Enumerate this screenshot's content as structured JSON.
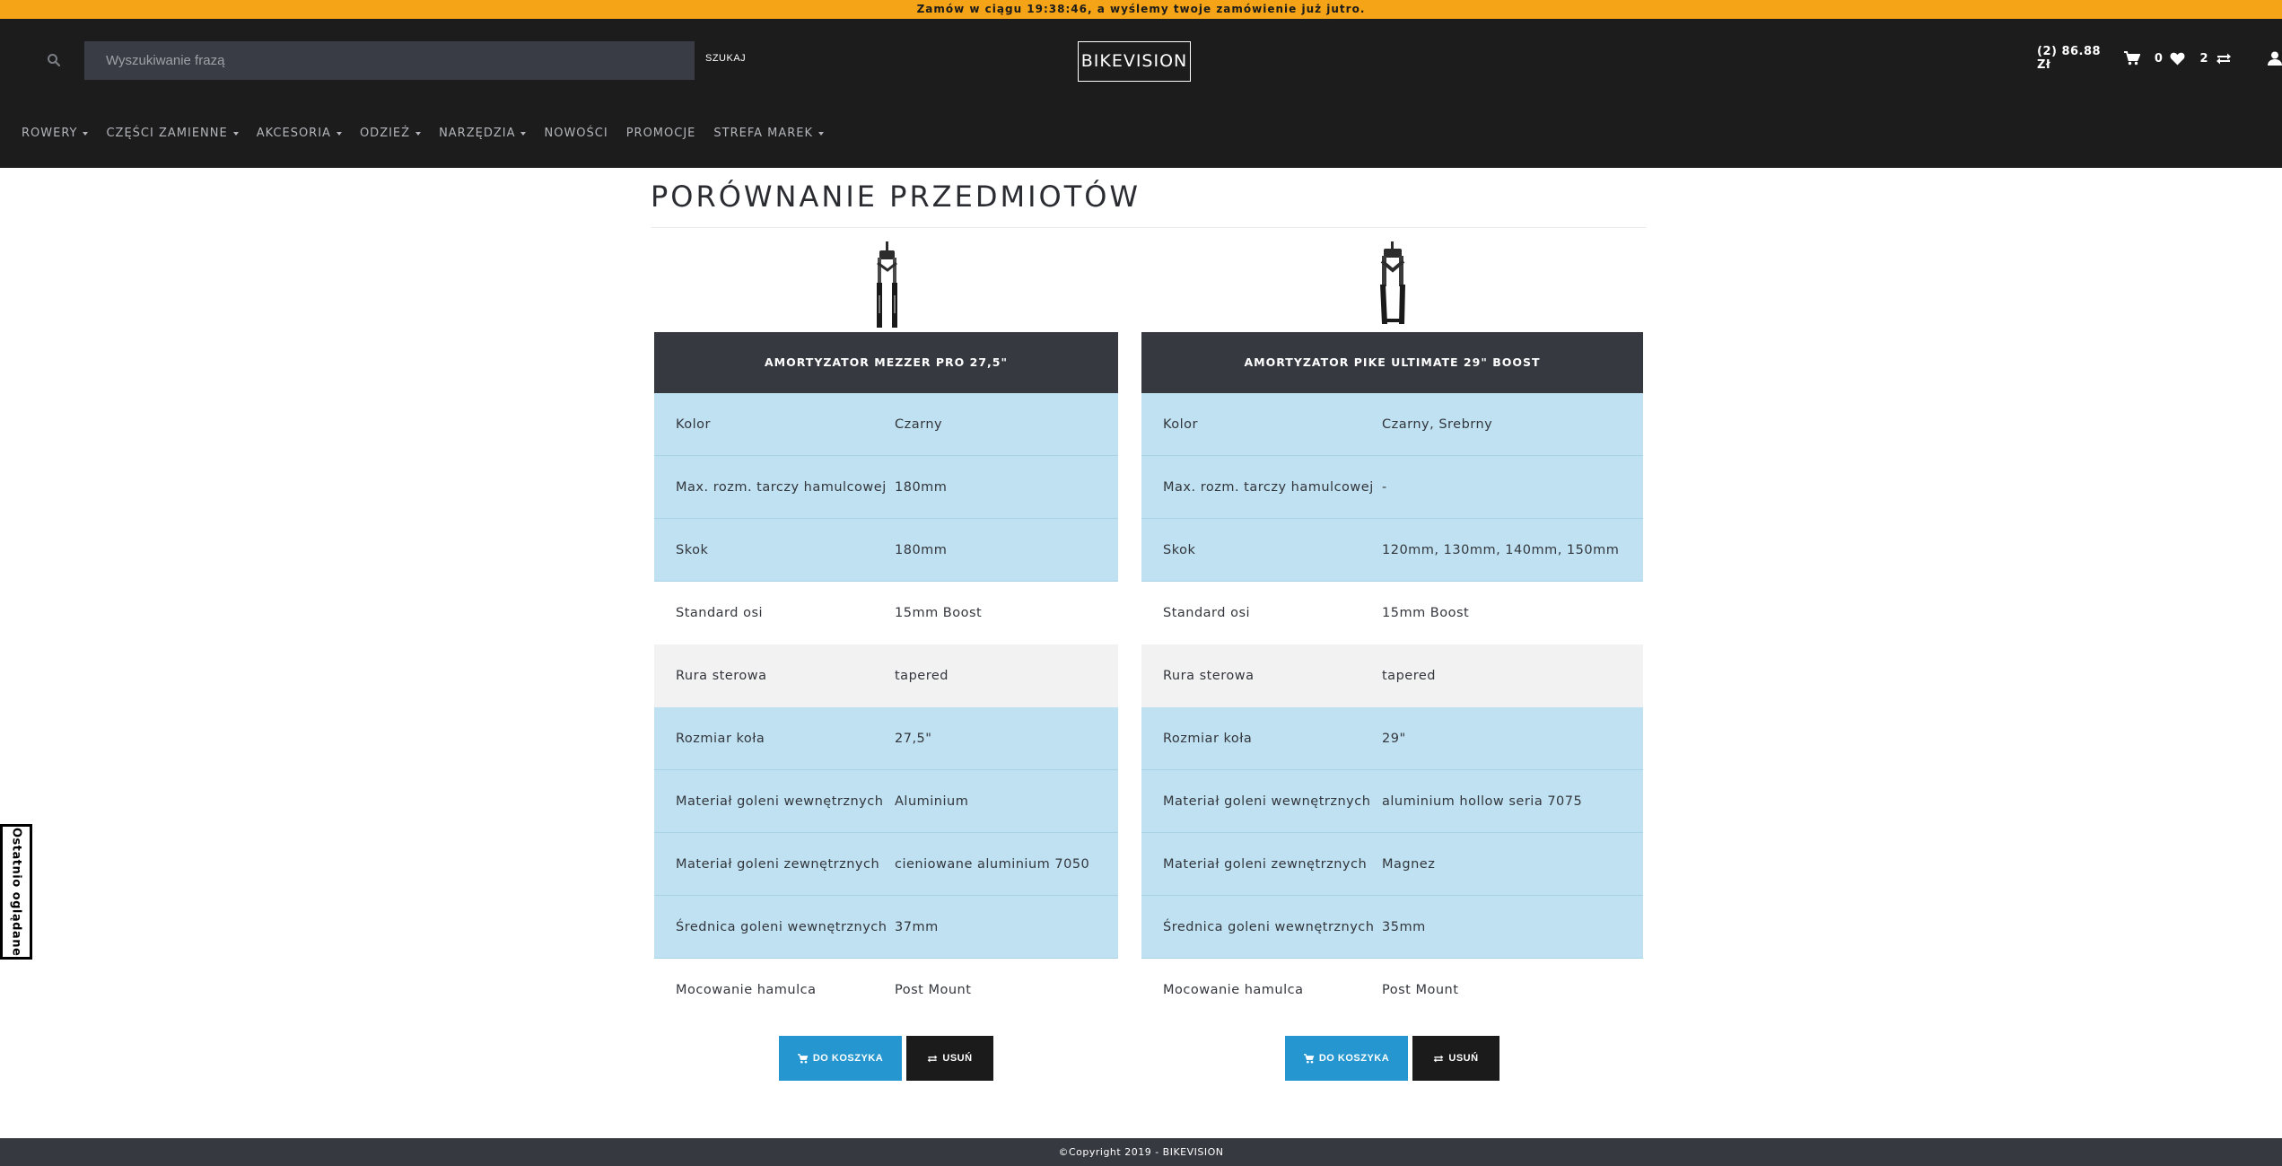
{
  "promo_bar": {
    "text": "Zamów w ciągu 19:38:46, a wyślemy twoje zamówienie już jutro."
  },
  "header": {
    "search": {
      "placeholder": "Wyszukiwanie frazą",
      "button_label": "SZUKAJ",
      "icon": "search-icon"
    },
    "logo": "BIKEVISION",
    "cart": {
      "label": "(2) 86.88 Zł",
      "icon": "cart-icon"
    },
    "wishlist": {
      "count": "0",
      "icon": "heart-icon"
    },
    "compare": {
      "count": "2",
      "icon": "compare-icon"
    },
    "account": {
      "icon": "user-icon"
    }
  },
  "nav": [
    {
      "label": "ROWERY",
      "has_dropdown": true
    },
    {
      "label": "CZĘŚCI ZAMIENNE",
      "has_dropdown": true
    },
    {
      "label": "AKCESORIA",
      "has_dropdown": true
    },
    {
      "label": "ODZIEŻ",
      "has_dropdown": true
    },
    {
      "label": "NARZĘDZIA",
      "has_dropdown": true
    },
    {
      "label": "NOWOŚCI",
      "has_dropdown": false
    },
    {
      "label": "PROMOCJE",
      "has_dropdown": false
    },
    {
      "label": "STREFA MAREK",
      "has_dropdown": true
    }
  ],
  "page_title": "PORÓWNANIE PRZEDMIOTÓW",
  "products": [
    {
      "name": "AMORTYZATOR MEZZER PRO 27,5\"",
      "specs": [
        {
          "label": "Kolor",
          "value": "Czarny"
        },
        {
          "label": "Max. rozm. tarczy hamulcowej",
          "value": "180mm"
        },
        {
          "label": "Skok",
          "value": "180mm"
        },
        {
          "label": "Standard osi",
          "value": "15mm Boost"
        },
        {
          "label": "Rura sterowa",
          "value": "tapered"
        },
        {
          "label": "Rozmiar koła",
          "value": "27,5\""
        },
        {
          "label": "Materiał goleni wewnętrznych",
          "value": "Aluminium"
        },
        {
          "label": "Materiał goleni zewnętrznych",
          "value": "cieniowane aluminium 7050"
        },
        {
          "label": "Średnica goleni wewnętrznych",
          "value": "37mm"
        },
        {
          "label": "Mocowanie hamulca",
          "value": "Post Mount"
        }
      ],
      "cart_button": "DO KOSZYKA",
      "remove_button": "USUŃ"
    },
    {
      "name": "AMORTYZATOR PIKE ULTIMATE 29\" BOOST",
      "specs": [
        {
          "label": "Kolor",
          "value": "Czarny, Srebrny"
        },
        {
          "label": "Max. rozm. tarczy hamulcowej",
          "value": "-"
        },
        {
          "label": "Skok",
          "value": "120mm, 130mm, 140mm, 150mm"
        },
        {
          "label": "Standard osi",
          "value": "15mm Boost"
        },
        {
          "label": "Rura sterowa",
          "value": "tapered"
        },
        {
          "label": "Rozmiar koła",
          "value": "29\""
        },
        {
          "label": "Materiał goleni wewnętrznych",
          "value": "aluminium hollow seria 7075"
        },
        {
          "label": "Materiał goleni zewnętrznych",
          "value": "Magnez"
        },
        {
          "label": "Średnica goleni wewnętrznych",
          "value": "35mm"
        },
        {
          "label": "Mocowanie hamulca",
          "value": "Post Mount"
        }
      ],
      "cart_button": "DO KOSZYKA",
      "remove_button": "USUŃ"
    }
  ],
  "row_styles": [
    "blue",
    "blue",
    "blue",
    "white",
    "grey",
    "blue",
    "blue",
    "blue",
    "blue",
    "white"
  ],
  "side_tab": "Ostatnio oglądane",
  "footer": "©Copyright 2019 - BIKEVISION",
  "colors": {
    "promo": "#f4a416",
    "header": "#1c1c1c",
    "accent": "#2596cf",
    "row_blue": "#bfe1f1",
    "product_header": "#363940"
  }
}
